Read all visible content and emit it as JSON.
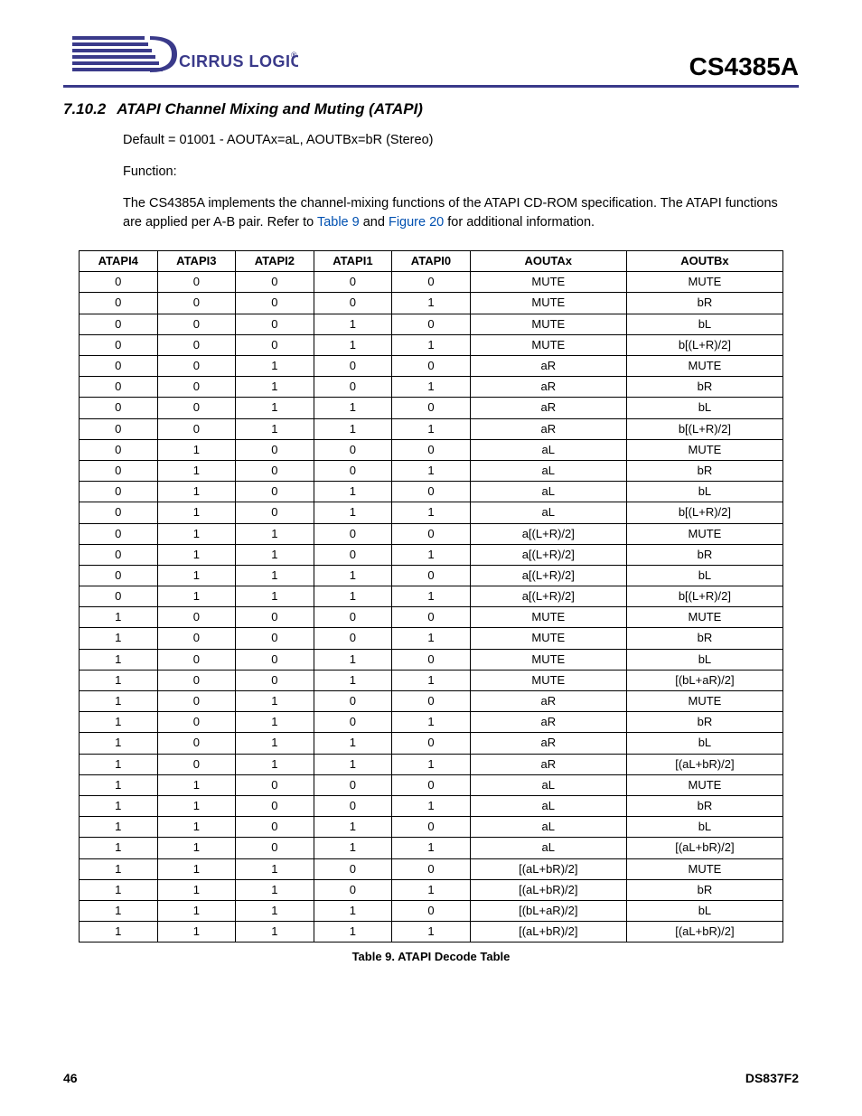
{
  "header": {
    "brand": "CIRRUS LOGIC",
    "reg_mark": "®",
    "doc_title": "CS4385A"
  },
  "section": {
    "number": "7.10.2",
    "title": "ATAPI Channel Mixing and Muting (ATAPI)"
  },
  "body": {
    "default_line": "Default = 01001 - AOUTAx=aL, AOUTBx=bR (Stereo)",
    "function_label": "Function:",
    "desc_1": "The CS4385A implements the channel-mixing functions of the ATAPI CD-ROM specification. The ATAPI functions are applied per A-B pair. Refer to ",
    "link_table": "Table 9",
    "desc_and": " and ",
    "link_figure": "Figure 20",
    "desc_2": " for additional information."
  },
  "table": {
    "headers": [
      "ATAPI4",
      "ATAPI3",
      "ATAPI2",
      "ATAPI1",
      "ATAPI0",
      "AOUTAx",
      "AOUTBx"
    ],
    "rows": [
      [
        "0",
        "0",
        "0",
        "0",
        "0",
        "MUTE",
        "MUTE"
      ],
      [
        "0",
        "0",
        "0",
        "0",
        "1",
        "MUTE",
        "bR"
      ],
      [
        "0",
        "0",
        "0",
        "1",
        "0",
        "MUTE",
        "bL"
      ],
      [
        "0",
        "0",
        "0",
        "1",
        "1",
        "MUTE",
        "b[(L+R)/2]"
      ],
      [
        "0",
        "0",
        "1",
        "0",
        "0",
        "aR",
        "MUTE"
      ],
      [
        "0",
        "0",
        "1",
        "0",
        "1",
        "aR",
        "bR"
      ],
      [
        "0",
        "0",
        "1",
        "1",
        "0",
        "aR",
        "bL"
      ],
      [
        "0",
        "0",
        "1",
        "1",
        "1",
        "aR",
        "b[(L+R)/2]"
      ],
      [
        "0",
        "1",
        "0",
        "0",
        "0",
        "aL",
        "MUTE"
      ],
      [
        "0",
        "1",
        "0",
        "0",
        "1",
        "aL",
        "bR"
      ],
      [
        "0",
        "1",
        "0",
        "1",
        "0",
        "aL",
        "bL"
      ],
      [
        "0",
        "1",
        "0",
        "1",
        "1",
        "aL",
        "b[(L+R)/2]"
      ],
      [
        "0",
        "1",
        "1",
        "0",
        "0",
        "a[(L+R)/2]",
        "MUTE"
      ],
      [
        "0",
        "1",
        "1",
        "0",
        "1",
        "a[(L+R)/2]",
        "bR"
      ],
      [
        "0",
        "1",
        "1",
        "1",
        "0",
        "a[(L+R)/2]",
        "bL"
      ],
      [
        "0",
        "1",
        "1",
        "1",
        "1",
        "a[(L+R)/2]",
        "b[(L+R)/2]"
      ],
      [
        "1",
        "0",
        "0",
        "0",
        "0",
        "MUTE",
        "MUTE"
      ],
      [
        "1",
        "0",
        "0",
        "0",
        "1",
        "MUTE",
        "bR"
      ],
      [
        "1",
        "0",
        "0",
        "1",
        "0",
        "MUTE",
        "bL"
      ],
      [
        "1",
        "0",
        "0",
        "1",
        "1",
        "MUTE",
        "[(bL+aR)/2]"
      ],
      [
        "1",
        "0",
        "1",
        "0",
        "0",
        "aR",
        "MUTE"
      ],
      [
        "1",
        "0",
        "1",
        "0",
        "1",
        "aR",
        "bR"
      ],
      [
        "1",
        "0",
        "1",
        "1",
        "0",
        "aR",
        "bL"
      ],
      [
        "1",
        "0",
        "1",
        "1",
        "1",
        "aR",
        "[(aL+bR)/2]"
      ],
      [
        "1",
        "1",
        "0",
        "0",
        "0",
        "aL",
        "MUTE"
      ],
      [
        "1",
        "1",
        "0",
        "0",
        "1",
        "aL",
        "bR"
      ],
      [
        "1",
        "1",
        "0",
        "1",
        "0",
        "aL",
        "bL"
      ],
      [
        "1",
        "1",
        "0",
        "1",
        "1",
        "aL",
        "[(aL+bR)/2]"
      ],
      [
        "1",
        "1",
        "1",
        "0",
        "0",
        "[(aL+bR)/2]",
        "MUTE"
      ],
      [
        "1",
        "1",
        "1",
        "0",
        "1",
        "[(aL+bR)/2]",
        "bR"
      ],
      [
        "1",
        "1",
        "1",
        "1",
        "0",
        "[(bL+aR)/2]",
        "bL"
      ],
      [
        "1",
        "1",
        "1",
        "1",
        "1",
        "[(aL+bR)/2]",
        "[(aL+bR)/2]"
      ]
    ],
    "caption": "Table 9. ATAPI Decode Table"
  },
  "footer": {
    "page": "46",
    "doc_id": "DS837F2"
  }
}
